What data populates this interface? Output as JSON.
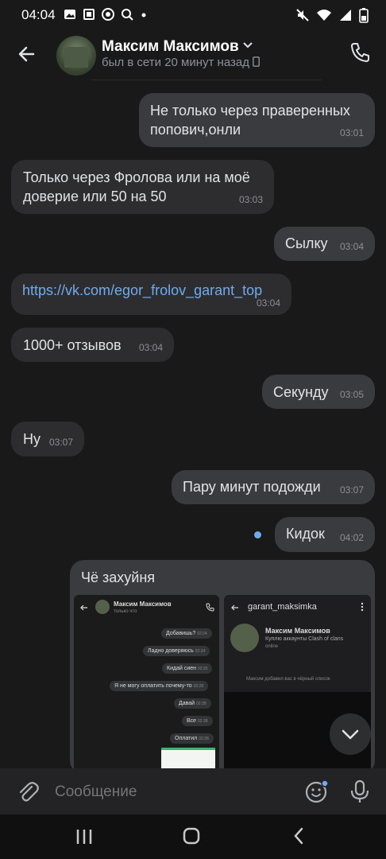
{
  "status_bar": {
    "time": "04:04"
  },
  "header": {
    "name": "Максим Максимов",
    "status": "был в сети 20 минут назад"
  },
  "messages": [
    {
      "text": "Не только через праверенных попович,онли",
      "time": "03:01",
      "direction": "out"
    },
    {
      "text": "Только через Фролова или на моё доверие или 50 на 50",
      "time": "03:03",
      "direction": "in"
    },
    {
      "text": "Сылку",
      "time": "03:04",
      "direction": "out"
    },
    {
      "text": "https://vk.com/egor_frolov_garant_top",
      "time": "03:04",
      "direction": "in"
    },
    {
      "text": "1000+ отзывов",
      "time": "03:04",
      "direction": "in"
    },
    {
      "text": "Секунду",
      "time": "03:05",
      "direction": "out"
    },
    {
      "text": "Ну",
      "time": "03:07",
      "direction": "in"
    },
    {
      "text": "Пару минут подожди",
      "time": "03:07",
      "direction": "out"
    },
    {
      "text": "Кидок",
      "time": "04:02",
      "direction": "out"
    }
  ],
  "attachment": {
    "caption": "Чё захуйня",
    "left_shot": {
      "name": "Максим Максимов",
      "status": "только что",
      "bubbles": [
        {
          "text": "Добавишь?",
          "time": "02:24"
        },
        {
          "text": "Ладно доверяюсь",
          "time": "02:24"
        },
        {
          "text": "Кидай сиен",
          "time": "02:25"
        },
        {
          "text": "Я не могу оплатить почему-то",
          "time": "02:28"
        },
        {
          "text": "Давай",
          "time": "02:28"
        },
        {
          "text": "Все",
          "time": "02:28"
        },
        {
          "text": "Оплатил",
          "time": "02:28"
        }
      ]
    },
    "right_shot": {
      "title": "garant_maksimka",
      "name": "Максим Максимов",
      "desc": "Куплю аккаунты Clash of clans",
      "status": "online",
      "notice": "Максим добавил вас в чёрный список"
    }
  },
  "composer": {
    "placeholder": "Сообщение"
  }
}
